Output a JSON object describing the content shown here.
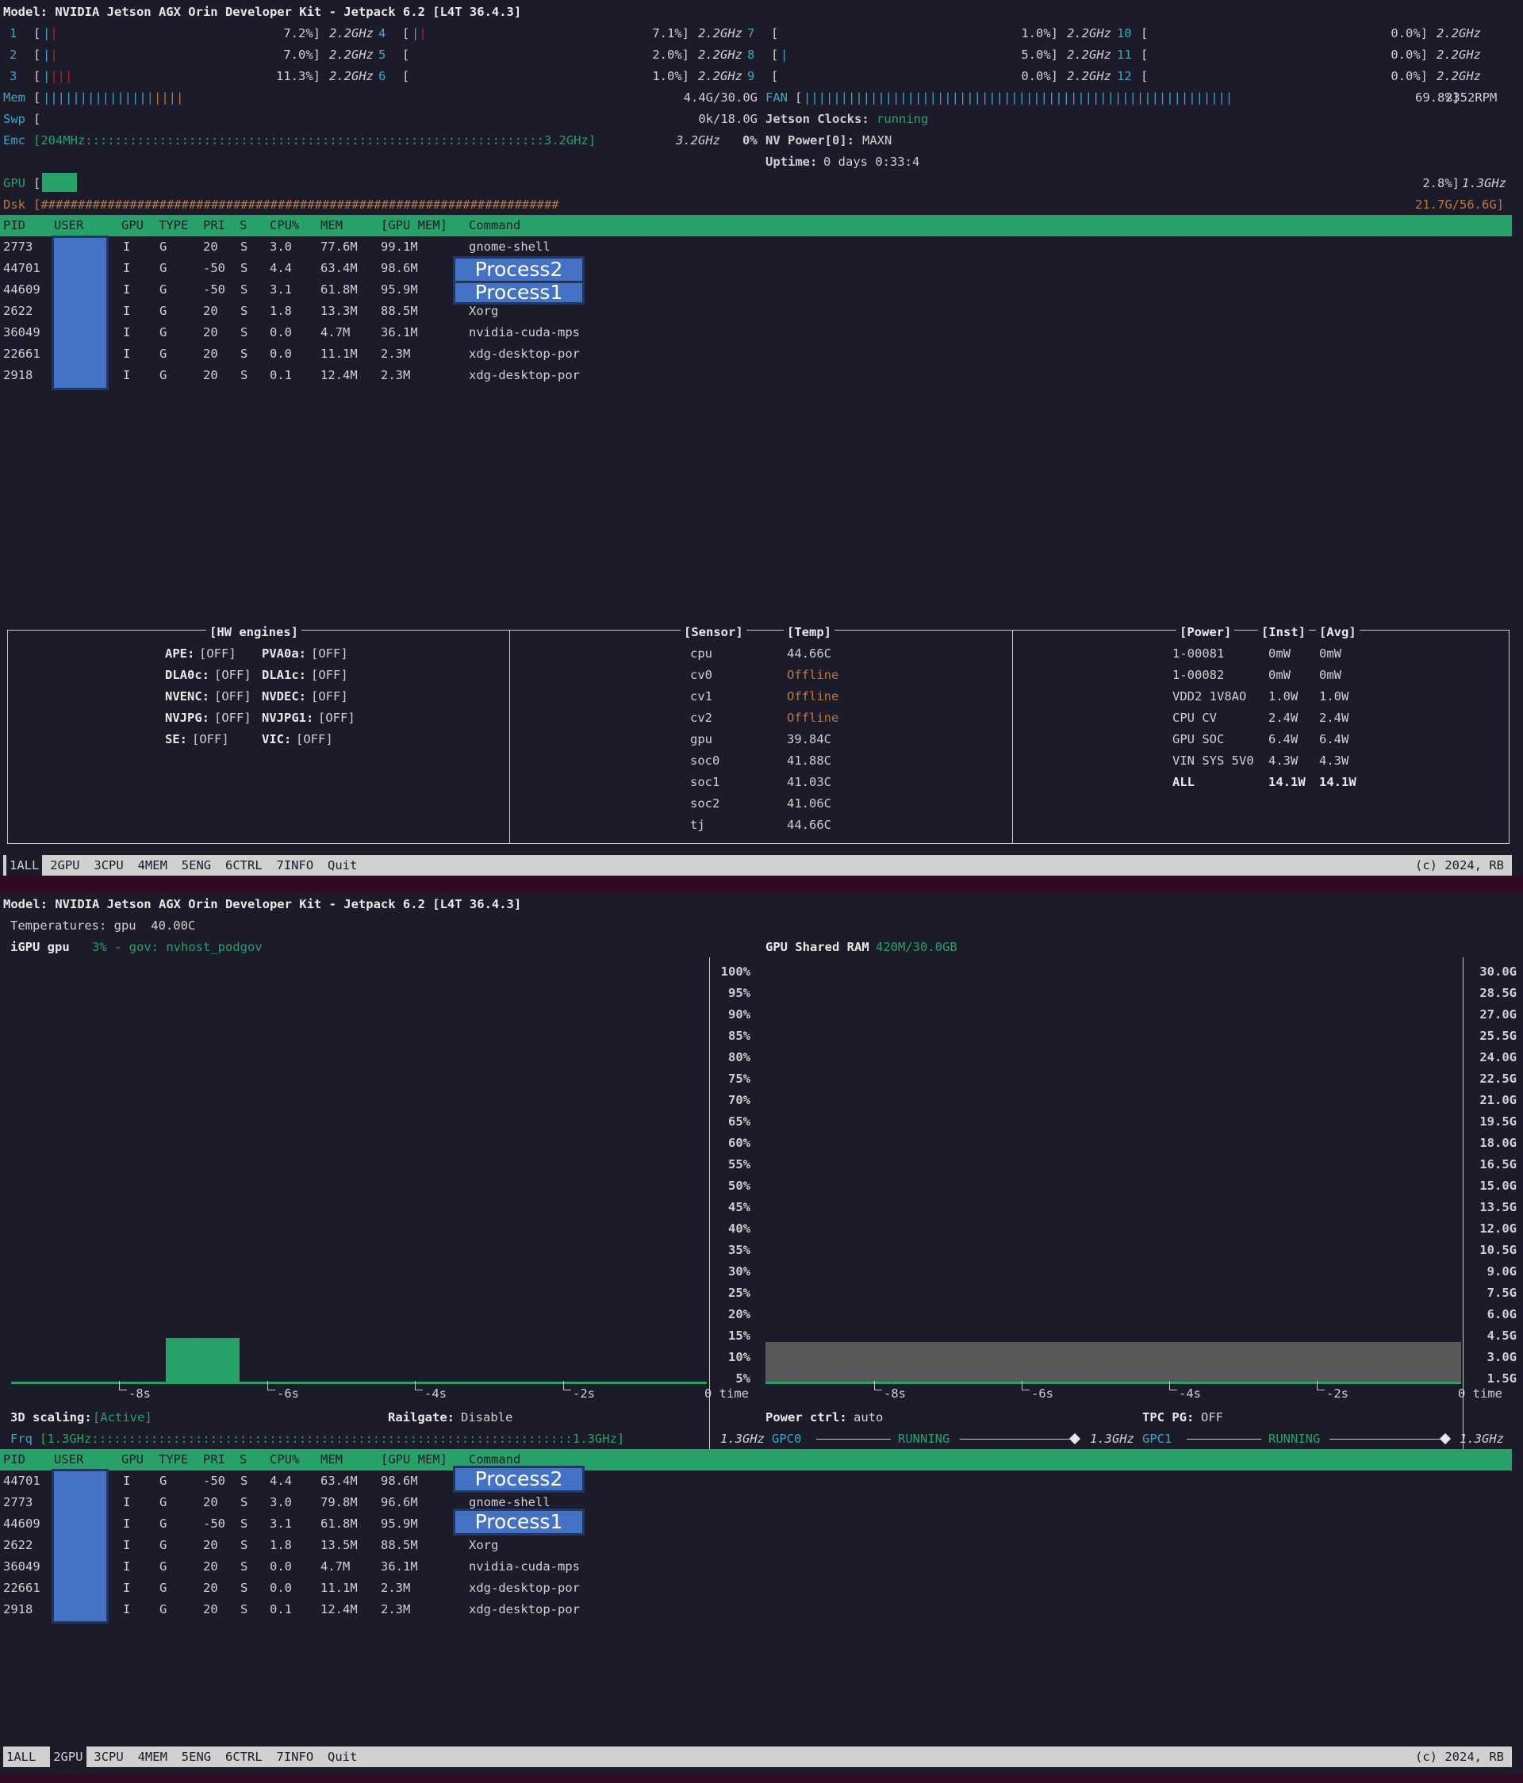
{
  "pane1": {
    "model": "Model: NVIDIA Jetson AGX Orin Developer Kit - Jetpack 6.2 [L4T 36.4.3]",
    "cpus": [
      {
        "id": "1",
        "pct": "7.2%]",
        "freq": "2.2GHz"
      },
      {
        "id": "2",
        "pct": "7.0%]",
        "freq": "2.2GHz"
      },
      {
        "id": "3",
        "pct": "11.3%]",
        "freq": "2.2GHz"
      },
      {
        "id": "4",
        "pct": "7.1%]",
        "freq": "2.2GHz"
      },
      {
        "id": "5",
        "pct": "2.0%]",
        "freq": "2.2GHz"
      },
      {
        "id": "6",
        "pct": "1.0%]",
        "freq": "2.2GHz"
      },
      {
        "id": "7",
        "pct": "1.0%]",
        "freq": "2.2GHz"
      },
      {
        "id": "8",
        "pct": "5.0%]",
        "freq": "2.2GHz"
      },
      {
        "id": "9",
        "pct": "0.0%]",
        "freq": "2.2GHz"
      },
      {
        "id": "10",
        "pct": "0.0%]",
        "freq": "2.2GHz"
      },
      {
        "id": "11",
        "pct": "0.0%]",
        "freq": "2.2GHz"
      },
      {
        "id": "12",
        "pct": "0.0%]",
        "freq": "2.2GHz"
      }
    ],
    "mem_label": "Mem",
    "mem_value": "4.4G/30.0G",
    "fan_label": "FAN",
    "fan_value": "69.8%]",
    "fan_rpm": "2352RPM",
    "swp_label": "Swp",
    "swp_value": "0k/18.0G",
    "clocks_label": "Jetson Clocks:",
    "clocks_value": "running",
    "emc_label": "Emc",
    "emc_bar": "[204MHz::::::::::::::::::::::::::::::::::::::::::::::::::::::::::::::3.2GHz]",
    "emc_freq": "3.2GHz",
    "emc_pct": "0%",
    "nvpower": "NV Power[0]:",
    "nvpower_value": "MAXN",
    "uptime_label": "Uptime:",
    "uptime_value": "0 days 0:33:4",
    "gpu_label": "GPU",
    "gpu_value": "2.8%]",
    "gpu_freq": "1.3GHz",
    "dsk_label": "Dsk",
    "dsk_bar": "[######################################################################",
    "dsk_value": "21.7G/56.6G]",
    "processes": [
      {
        "pid": "2773",
        "gpu": "I",
        "type": "G",
        "pri": "20",
        "s": "S",
        "cpu": "3.0",
        "mem": "77.6M",
        "gpumem": "99.1M",
        "cmd": "gnome-shell"
      },
      {
        "pid": "44701",
        "gpu": "I",
        "type": "G",
        "pri": "-50",
        "s": "S",
        "cpu": "4.4",
        "mem": "63.4M",
        "gpumem": "98.6M",
        "cmd": ""
      },
      {
        "pid": "44609",
        "gpu": "I",
        "type": "G",
        "pri": "-50",
        "s": "S",
        "cpu": "3.1",
        "mem": "61.8M",
        "gpumem": "95.9M",
        "cmd": ""
      },
      {
        "pid": "2622",
        "gpu": "I",
        "type": "G",
        "pri": "20",
        "s": "S",
        "cpu": "1.8",
        "mem": "13.3M",
        "gpumem": "88.5M",
        "cmd": "Xorg"
      },
      {
        "pid": "36049",
        "gpu": "I",
        "type": "G",
        "pri": "20",
        "s": "S",
        "cpu": "0.0",
        "mem": "4.7M",
        "gpumem": "36.1M",
        "cmd": "nvidia-cuda-mps"
      },
      {
        "pid": "22661",
        "gpu": "I",
        "type": "G",
        "pri": "20",
        "s": "S",
        "cpu": "0.0",
        "mem": "11.1M",
        "gpumem": "2.3M",
        "cmd": "xdg-desktop-por"
      },
      {
        "pid": "2918",
        "gpu": "I",
        "type": "G",
        "pri": "20",
        "s": "S",
        "cpu": "0.1",
        "mem": "12.4M",
        "gpumem": "2.3M",
        "cmd": "xdg-desktop-por"
      }
    ],
    "overlay_process2": "Process2",
    "overlay_process1": "Process1",
    "hw_title": "[HW engines]",
    "hw": [
      {
        "name": "APE:",
        "val": "[OFF]",
        "name2": "PVA0a:",
        "val2": "[OFF]"
      },
      {
        "name": "DLA0c:",
        "val": "[OFF]",
        "name2": "DLA1c:",
        "val2": "[OFF]"
      },
      {
        "name": "NVENC:",
        "val": "[OFF]",
        "name2": "NVDEC:",
        "val2": "[OFF]"
      },
      {
        "name": "NVJPG:",
        "val": "[OFF]",
        "name2": "NVJPG1:",
        "val2": "[OFF]"
      },
      {
        "name": "SE:",
        "val": "[OFF]",
        "name2": "VIC:",
        "val2": "[OFF]"
      }
    ],
    "sensor_title": "[Sensor]",
    "temp_title": "[Temp]",
    "sensors": [
      {
        "name": "cpu",
        "val": "44.66C"
      },
      {
        "name": "cv0",
        "val": "Offline"
      },
      {
        "name": "cv1",
        "val": "Offline"
      },
      {
        "name": "cv2",
        "val": "Offline"
      },
      {
        "name": "gpu",
        "val": "39.84C"
      },
      {
        "name": "soc0",
        "val": "41.88C"
      },
      {
        "name": "soc1",
        "val": "41.03C"
      },
      {
        "name": "soc2",
        "val": "41.06C"
      },
      {
        "name": "tj",
        "val": "44.66C"
      }
    ],
    "power_title": "[Power]",
    "inst_title": "[Inst]",
    "avg_title": "[Avg]",
    "power": [
      {
        "name": "1-00081",
        "inst": "0mW",
        "avg": "0mW"
      },
      {
        "name": "1-00082",
        "inst": "0mW",
        "avg": "0mW"
      },
      {
        "name": "VDD2 1V8AO",
        "inst": "1.0W",
        "avg": "1.0W"
      },
      {
        "name": "CPU CV",
        "inst": "2.4W",
        "avg": "2.4W"
      },
      {
        "name": "GPU SOC",
        "inst": "6.4W",
        "avg": "6.4W"
      },
      {
        "name": "VIN SYS 5V0",
        "inst": "4.3W",
        "avg": "4.3W"
      },
      {
        "name": "ALL",
        "inst": "14.1W",
        "avg": "14.1W"
      }
    ]
  },
  "headers": {
    "pid": "PID",
    "user": "USER",
    "gpu": "GPU",
    "type": "TYPE",
    "pri": "PRI",
    "s": "S",
    "cpu": "CPU%",
    "mem": "MEM",
    "gpumem": "[GPU MEM]",
    "cmd": "Command"
  },
  "menu": {
    "items": [
      {
        "num": "1",
        "label": "ALL"
      },
      {
        "num": "2",
        "label": "GPU"
      },
      {
        "num": "3",
        "label": "CPU"
      },
      {
        "num": "4",
        "label": "MEM"
      },
      {
        "num": "5",
        "label": "ENG"
      },
      {
        "num": "6",
        "label": "CTRL"
      },
      {
        "num": "7",
        "label": "INFO"
      }
    ],
    "quit": "Quit",
    "copyright": "(c) 2024, RB"
  },
  "pane2": {
    "model": "Model: NVIDIA Jetson AGX Orin Developer Kit - Jetpack 6.2 [L4T 36.4.3]",
    "temps": "Temperatures: gpu  40.00C",
    "igpu_label": "iGPU gpu",
    "igpu_value": "3% - gov: nvhost_podgov",
    "shared_label": "GPU Shared RAM",
    "shared_value": "420M/30.0GB",
    "scaling_label": "3D scaling:",
    "scaling_value": "[Active]",
    "railgate_label": "Railgate:",
    "railgate_value": "Disable",
    "powerctrl_label": "Power ctrl:",
    "powerctrl_value": "auto",
    "tpc_label": "TPC PG:",
    "tpc_value": "OFF",
    "frq_label": "Frq",
    "frq_bar": "[1.3GHz:::::::::::::::::::::::::::::::::::::::::::::::::::::::::::::::::1.3GHz]",
    "frq_value": "1.3GHz",
    "gpc0": "GPC0",
    "gpc0_status": "RUNNING",
    "gpc0_freq": "1.3GHz",
    "gpc1": "GPC1",
    "gpc1_status": "RUNNING",
    "gpc1_freq": "1.3GHz",
    "processes": [
      {
        "pid": "44701",
        "gpu": "I",
        "type": "G",
        "pri": "-50",
        "s": "S",
        "cpu": "4.4",
        "mem": "63.4M",
        "gpumem": "98.6M",
        "cmd": ""
      },
      {
        "pid": "2773",
        "gpu": "I",
        "type": "G",
        "pri": "20",
        "s": "S",
        "cpu": "3.0",
        "mem": "79.8M",
        "gpumem": "96.6M",
        "cmd": "gnome-shell"
      },
      {
        "pid": "44609",
        "gpu": "I",
        "type": "G",
        "pri": "-50",
        "s": "S",
        "cpu": "3.1",
        "mem": "61.8M",
        "gpumem": "95.9M",
        "cmd": ""
      },
      {
        "pid": "2622",
        "gpu": "I",
        "type": "G",
        "pri": "20",
        "s": "S",
        "cpu": "1.8",
        "mem": "13.5M",
        "gpumem": "88.5M",
        "cmd": "Xorg"
      },
      {
        "pid": "36049",
        "gpu": "I",
        "type": "G",
        "pri": "20",
        "s": "S",
        "cpu": "0.0",
        "mem": "4.7M",
        "gpumem": "36.1M",
        "cmd": "nvidia-cuda-mps"
      },
      {
        "pid": "22661",
        "gpu": "I",
        "type": "G",
        "pri": "20",
        "s": "S",
        "cpu": "0.0",
        "mem": "11.1M",
        "gpumem": "2.3M",
        "cmd": "xdg-desktop-por"
      },
      {
        "pid": "2918",
        "gpu": "I",
        "type": "G",
        "pri": "20",
        "s": "S",
        "cpu": "0.1",
        "mem": "12.4M",
        "gpumem": "2.3M",
        "cmd": "xdg-desktop-por"
      }
    ],
    "overlay_process2": "Process2",
    "overlay_process1": "Process1",
    "pct_ticks": [
      "100%",
      "95%",
      "90%",
      "85%",
      "80%",
      "75%",
      "70%",
      "65%",
      "60%",
      "55%",
      "50%",
      "45%",
      "40%",
      "35%",
      "30%",
      "25%",
      "20%",
      "15%",
      "10%",
      "5%"
    ],
    "ram_ticks": [
      "30.0G",
      "28.5G",
      "27.0G",
      "25.5G",
      "24.0G",
      "22.5G",
      "21.0G",
      "19.5G",
      "18.0G",
      "16.5G",
      "15.0G",
      "13.5G",
      "12.0G",
      "10.5G",
      "9.0G",
      "7.5G",
      "6.0G",
      "4.5G",
      "3.0G",
      "1.5G"
    ],
    "time_ticks": [
      "-8s",
      "-6s",
      "-4s",
      "-2s",
      "0 time"
    ]
  },
  "colors": {
    "accent": "#26a269",
    "cyan": "#3aa7c8",
    "bg": "#1b1b29",
    "mask": "#4472c4",
    "offline": "#c0773a"
  },
  "chart_data": [
    {
      "type": "bar",
      "title": "iGPU gpu",
      "y_unit": "%",
      "ylim": [
        0,
        100
      ],
      "x": [
        -10,
        -9,
        -8,
        -7,
        -6,
        -5,
        -4,
        -3,
        -2,
        -1,
        0
      ],
      "values": [
        0,
        0,
        0,
        0,
        0,
        11,
        11,
        0,
        0,
        0,
        0
      ]
    },
    {
      "type": "area",
      "title": "GPU Shared RAM",
      "y_unit": "G",
      "ylim": [
        0,
        30
      ],
      "x": [
        -10,
        0
      ],
      "values": [
        3.0,
        3.0
      ]
    }
  ]
}
